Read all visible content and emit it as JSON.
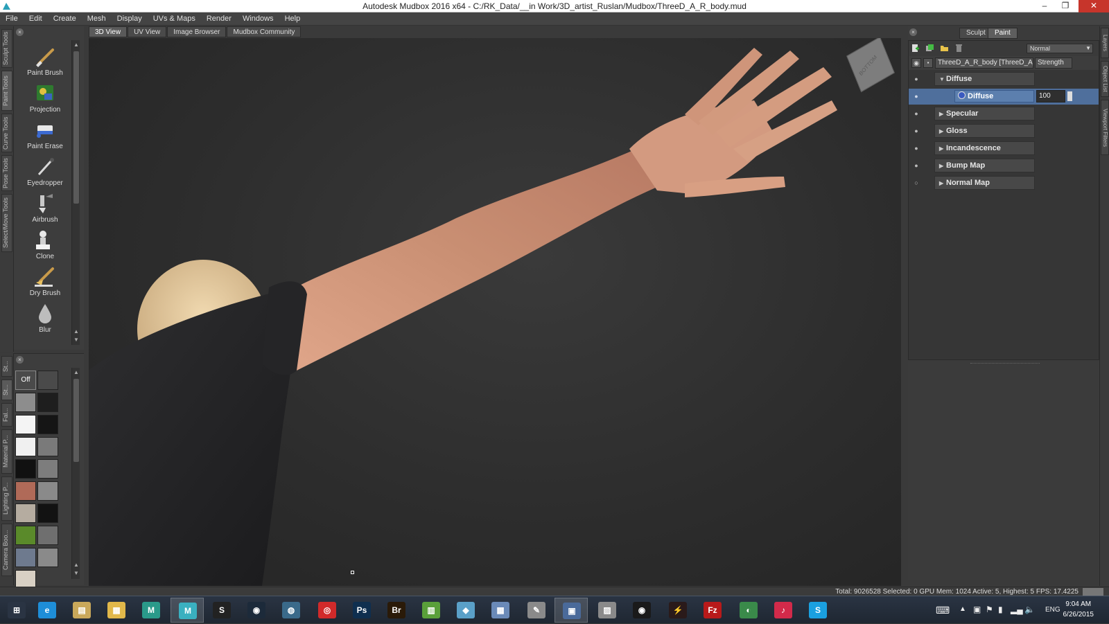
{
  "window": {
    "title": "Autodesk Mudbox 2016 x64 - C:/RK_Data/__in Work/3D_artist_Ruslan/Mudbox/ThreeD_A_R_body.mud",
    "minimize": "–",
    "restore": "❐",
    "close": "✕"
  },
  "menu": [
    "File",
    "Edit",
    "Create",
    "Mesh",
    "Display",
    "UVs & Maps",
    "Render",
    "Windows",
    "Help"
  ],
  "left_vtabs": [
    "Sculpt Tools",
    "Paint Tools",
    "Curve Tools",
    "Pose Tools",
    "Select/Move Tools"
  ],
  "tools": [
    {
      "label": "Paint Brush",
      "icon": "paint-brush-icon"
    },
    {
      "label": "Projection",
      "icon": "projection-icon"
    },
    {
      "label": "Paint Erase",
      "icon": "paint-erase-icon"
    },
    {
      "label": "Eyedropper",
      "icon": "eyedropper-icon"
    },
    {
      "label": "Airbrush",
      "icon": "airbrush-icon"
    },
    {
      "label": "Clone",
      "icon": "clone-icon"
    },
    {
      "label": "Dry Brush",
      "icon": "dry-brush-icon"
    },
    {
      "label": "Blur",
      "icon": "blur-icon"
    }
  ],
  "stamp_vtabs": [
    "St...",
    "St...",
    "Fal...",
    "Material P...",
    "Lighting P...",
    "Camera Boo..."
  ],
  "stamps": {
    "off_label": "Off",
    "colors": [
      "#4a4a4a",
      "#8d8d8d",
      "#1e1e1e",
      "#f4f4f4",
      "#151515",
      "#f0f0f0",
      "#7a7a7a",
      "#111111",
      "#7d7d7d",
      "#b06a58",
      "#8a8a8a",
      "#b5aca0",
      "#121212",
      "#5a8a2a",
      "#6f6f6f",
      "#6e7a8e",
      "#8a8a8a",
      "#d8d0c4"
    ]
  },
  "view_tabs": [
    {
      "label": "3D View",
      "active": true
    },
    {
      "label": "UV View",
      "active": false
    },
    {
      "label": "Image Browser",
      "active": false
    },
    {
      "label": "Mudbox Community",
      "active": false
    }
  ],
  "viewcube": {
    "label": "BOTTOM"
  },
  "right_panel": {
    "tabs": [
      {
        "label": "Sculpt",
        "active": false
      },
      {
        "label": "Paint",
        "active": true
      }
    ],
    "blend_mode": "Normal",
    "layer_name": "ThreeD_A_R_body [ThreeD_A_R_",
    "strength_label": "Strength",
    "channels": [
      {
        "label": "Diffuse",
        "expanded": true
      },
      {
        "label": "Specular",
        "expanded": false
      },
      {
        "label": "Gloss",
        "expanded": false
      },
      {
        "label": "Incandescence",
        "expanded": false
      },
      {
        "label": "Bump Map",
        "expanded": false
      },
      {
        "label": "Normal Map",
        "expanded": false
      }
    ],
    "selected_layer": {
      "label": "Diffuse",
      "strength": "100"
    }
  },
  "right_vtabs": [
    "Layers",
    "Object List",
    "Viewport Filters"
  ],
  "status": "Total: 9026528  Selected: 0 GPU Mem: 1024  Active: 5, Highest: 5  FPS: 17.4225",
  "taskbar": {
    "apps": [
      {
        "name": "start-button",
        "glyph": "⊞",
        "color": "#2a3443"
      },
      {
        "name": "internet-explorer-icon",
        "glyph": "e",
        "color": "#1e8ed8"
      },
      {
        "name": "file-manager-icon",
        "glyph": "▤",
        "color": "#c9a85a"
      },
      {
        "name": "file-explorer-icon",
        "glyph": "▦",
        "color": "#e1b84a"
      },
      {
        "name": "mudbox-icon",
        "glyph": "M",
        "color": "#2a9a8a"
      },
      {
        "name": "mudbox-active-icon",
        "glyph": "M",
        "color": "#3ab0c0"
      },
      {
        "name": "app-s-icon",
        "glyph": "S",
        "color": "#222222"
      },
      {
        "name": "steam-icon",
        "glyph": "◉",
        "color": "#1c2a3a"
      },
      {
        "name": "app-globe-icon",
        "glyph": "◍",
        "color": "#3a6a8a"
      },
      {
        "name": "creative-cloud-icon",
        "glyph": "◎",
        "color": "#d12a2a"
      },
      {
        "name": "photoshop-icon",
        "glyph": "Ps",
        "color": "#0f2f4f"
      },
      {
        "name": "bridge-icon",
        "glyph": "Br",
        "color": "#2a1a08"
      },
      {
        "name": "notes-icon",
        "glyph": "▥",
        "color": "#5aa03a"
      },
      {
        "name": "app-blue-icon",
        "glyph": "◆",
        "color": "#5aa0c8"
      },
      {
        "name": "calculator-icon",
        "glyph": "▦",
        "color": "#6a8ab8"
      },
      {
        "name": "paint-icon",
        "glyph": "✎",
        "color": "#8a8a8a"
      },
      {
        "name": "remote-desktop-icon",
        "glyph": "▣",
        "color": "#4a6a9a"
      },
      {
        "name": "image-viewer-icon",
        "glyph": "▨",
        "color": "#8a8a8a"
      },
      {
        "name": "camera-icon",
        "glyph": "◉",
        "color": "#1a1a1a"
      },
      {
        "name": "app-red-icon",
        "glyph": "⚡",
        "color": "#2a1a1a"
      },
      {
        "name": "filezilla-icon",
        "glyph": "Fz",
        "color": "#b81a1a"
      },
      {
        "name": "app-earth-icon",
        "glyph": "◐",
        "color": "#3a8a4a"
      },
      {
        "name": "itunes-icon",
        "glyph": "♪",
        "color": "#d22a4a"
      },
      {
        "name": "skype-icon",
        "glyph": "S",
        "color": "#1aa0e0"
      }
    ],
    "language": "ENG",
    "time": "9:04 AM",
    "date": "6/26/2015"
  }
}
